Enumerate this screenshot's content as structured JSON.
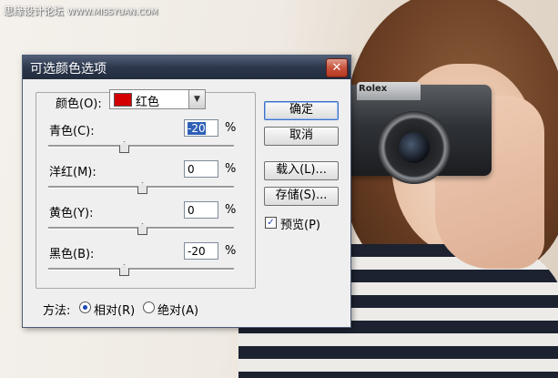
{
  "watermark": {
    "text": "思缘设计论坛",
    "url": "WWW.MISSYUAN.COM"
  },
  "photo": {
    "camera_brand": "Rolex"
  },
  "dialog": {
    "title": "可选颜色选项",
    "colors_label": "颜色(O):",
    "colors_value": "红色",
    "colors_swatch": "#d40000",
    "fields": [
      {
        "label": "青色(C):",
        "value": "-20",
        "unit": "%"
      },
      {
        "label": "洋红(M):",
        "value": "0",
        "unit": "%"
      },
      {
        "label": "黄色(Y):",
        "value": "0",
        "unit": "%"
      },
      {
        "label": "黑色(B):",
        "value": "-20",
        "unit": "%"
      }
    ],
    "buttons": {
      "ok": "确定",
      "cancel": "取消",
      "load": "载入(L)...",
      "save": "存储(S)..."
    },
    "preview": {
      "label": "预览(P)",
      "checked": true
    },
    "method": {
      "label": "方法:",
      "relative": "相对(R)",
      "absolute": "绝对(A)",
      "selected": "relative"
    }
  }
}
